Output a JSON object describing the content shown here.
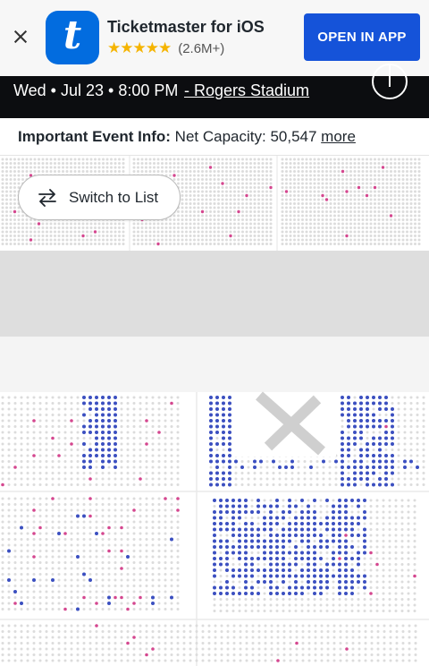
{
  "banner": {
    "app_name": "Ticketmaster for iOS",
    "stars": "★★★★★",
    "rating_count": "(2.6M+)",
    "open_label": "OPEN IN APP",
    "app_icon_letter": "t"
  },
  "event": {
    "date_time": "Wed • Jul 23 • 8:00 PM",
    "venue": " - Rogers Stadium"
  },
  "info": {
    "label": "Important Event Info:",
    "text": " Net Capacity: 50,547 ",
    "more": "more"
  },
  "map": {
    "switch_label": "Switch to List",
    "colors": {
      "available": "#3b4fc0",
      "resale": "#d4478f",
      "resale_light": "#e9a7c8",
      "unavailable": "#dcdcdc",
      "stage_band": "#dedede",
      "stage_area": "#f4f4f4",
      "blocked": "#cfcfcf"
    }
  }
}
